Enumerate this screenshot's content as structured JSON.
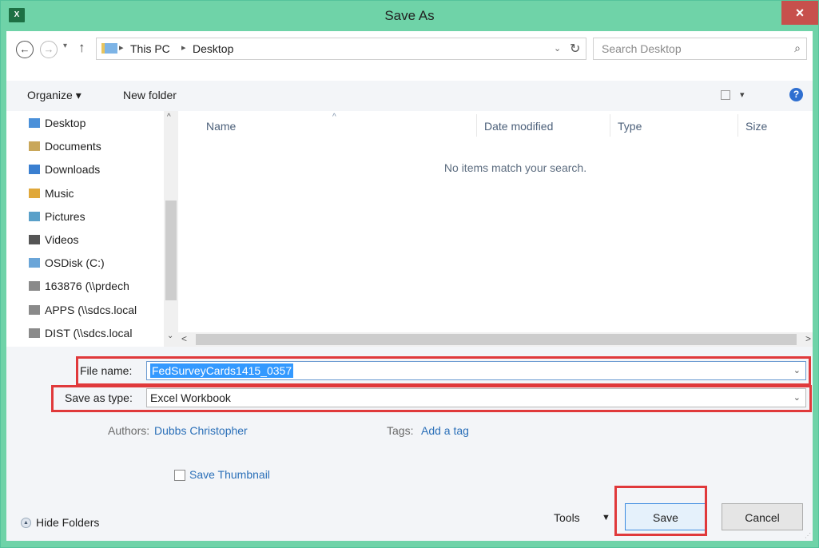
{
  "window": {
    "title": "Save As",
    "app_icon": "X",
    "close_glyph": "×"
  },
  "address": {
    "back_glyph": "←",
    "forward_glyph": "→",
    "history_glyph": "▾",
    "up_glyph": "↑",
    "breadcrumb": [
      "This PC",
      "Desktop"
    ],
    "separator": "▸",
    "dropdown_glyph": "⌄",
    "refresh_glyph": "↻"
  },
  "search": {
    "placeholder": "Search Desktop",
    "icon_glyph": "⌕"
  },
  "toolbar": {
    "organize_label": "Organize ▾",
    "new_folder_label": "New folder",
    "view_chev": "▾",
    "help_glyph": "?"
  },
  "nav_pane": {
    "items": [
      {
        "label": "Desktop",
        "icon": "desktop-folder-icon",
        "color": "#4a90d9"
      },
      {
        "label": "Documents",
        "icon": "documents-folder-icon",
        "color": "#c9a75a"
      },
      {
        "label": "Downloads",
        "icon": "downloads-folder-icon",
        "color": "#3a7fd0"
      },
      {
        "label": "Music",
        "icon": "music-folder-icon",
        "color": "#e0a83a"
      },
      {
        "label": "Pictures",
        "icon": "pictures-folder-icon",
        "color": "#5aa0c9"
      },
      {
        "label": "Videos",
        "icon": "videos-folder-icon",
        "color": "#555555"
      },
      {
        "label": "OSDisk (C:)",
        "icon": "drive-icon",
        "color": "#6aa5d8"
      },
      {
        "label": "163876 (\\\\prdech",
        "icon": "network-drive-icon",
        "color": "#8a8a8a"
      },
      {
        "label": "APPS (\\\\sdcs.local",
        "icon": "network-drive-icon",
        "color": "#8a8a8a"
      },
      {
        "label": "DIST (\\\\sdcs.local",
        "icon": "network-drive-icon",
        "color": "#8a8a8a"
      }
    ],
    "scroll_up": "^",
    "scroll_down": "⌄"
  },
  "file_list": {
    "columns": [
      "Name",
      "Date modified",
      "Type",
      "Size"
    ],
    "sort_caret": "^",
    "empty_message": "No items match your search.",
    "scroll_left": "<",
    "scroll_right": ">"
  },
  "form": {
    "file_name_label": "File name:",
    "file_name_value": "FedSurveyCards1415_0357",
    "save_type_label": "Save as type:",
    "save_type_value": "Excel Workbook",
    "dropdown_glyph": "⌄",
    "authors_label": "Authors:",
    "authors_value": "Dubbs Christopher",
    "tags_label": "Tags:",
    "tags_value": "Add a tag",
    "thumbnail_label": "Save Thumbnail",
    "hide_folders_label": "Hide Folders",
    "hide_glyph": "▲",
    "tools_label": "Tools",
    "tools_chev": "▼",
    "save_label": "Save",
    "cancel_label": "Cancel"
  },
  "colors": {
    "titlebar": "#6fd3a8",
    "close": "#c7504c",
    "highlight": "#e0393b",
    "selection": "#3399ff",
    "link": "#2a6fb8"
  }
}
